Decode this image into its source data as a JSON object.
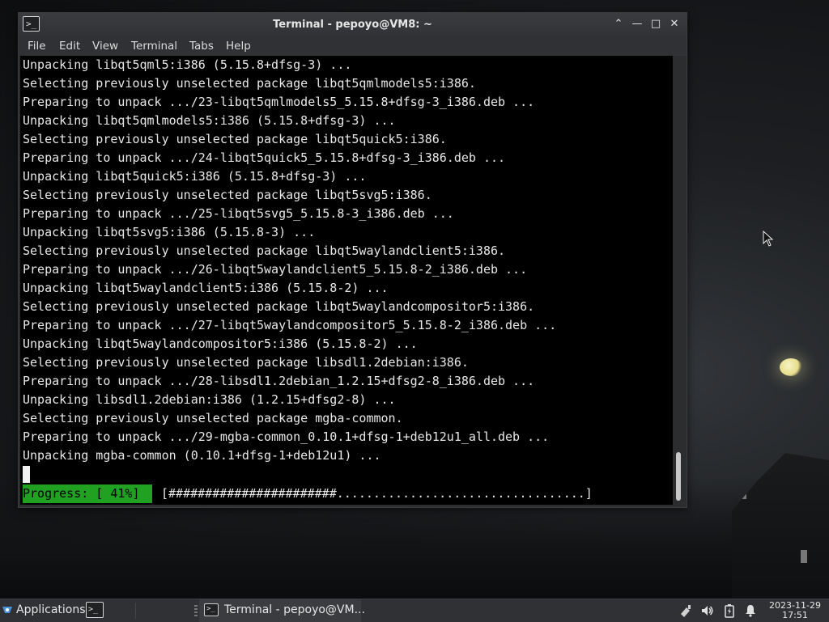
{
  "window": {
    "title": "Terminal - pepoyo@VM8: ~",
    "controls": {
      "maximize_up": "⌃",
      "minimize": "—",
      "maximize": "□",
      "close": "✕"
    }
  },
  "menubar": {
    "items": [
      "File",
      "Edit",
      "View",
      "Terminal",
      "Tabs",
      "Help"
    ]
  },
  "terminal": {
    "lines": [
      "Unpacking libqt5qml5:i386 (5.15.8+dfsg-3) ...",
      "Selecting previously unselected package libqt5qmlmodels5:i386.",
      "Preparing to unpack .../23-libqt5qmlmodels5_5.15.8+dfsg-3_i386.deb ...",
      "Unpacking libqt5qmlmodels5:i386 (5.15.8+dfsg-3) ...",
      "Selecting previously unselected package libqt5quick5:i386.",
      "Preparing to unpack .../24-libqt5quick5_5.15.8+dfsg-3_i386.deb ...",
      "Unpacking libqt5quick5:i386 (5.15.8+dfsg-3) ...",
      "Selecting previously unselected package libqt5svg5:i386.",
      "Preparing to unpack .../25-libqt5svg5_5.15.8-3_i386.deb ...",
      "Unpacking libqt5svg5:i386 (5.15.8-3) ...",
      "Selecting previously unselected package libqt5waylandclient5:i386.",
      "Preparing to unpack .../26-libqt5waylandclient5_5.15.8-2_i386.deb ...",
      "Unpacking libqt5waylandclient5:i386 (5.15.8-2) ...",
      "Selecting previously unselected package libqt5waylandcompositor5:i386.",
      "Preparing to unpack .../27-libqt5waylandcompositor5_5.15.8-2_i386.deb ...",
      "Unpacking libqt5waylandcompositor5:i386 (5.15.8-2) ...",
      "Selecting previously unselected package libsdl1.2debian:i386.",
      "Preparing to unpack .../28-libsdl1.2debian_1.2.15+dfsg2-8_i386.deb ...",
      "Unpacking libsdl1.2debian:i386 (1.2.15+dfsg2-8) ...",
      "Selecting previously unselected package mgba-common.",
      "Preparing to unpack .../29-mgba-common_0.10.1+dfsg-1+deb12u1_all.deb ...",
      "Unpacking mgba-common (0.10.1+dfsg-1+deb12u1) ..."
    ],
    "progress_label": "Progress: [ 41%]",
    "progress_bar": "[#######################..................................]",
    "progress_fraction": 0.41,
    "progress_color": "#21a121"
  },
  "taskbar": {
    "applications_label": "Applications",
    "task_label": "Terminal - pepoyo@VM...",
    "tray_icons": [
      "network-wired-icon",
      "volume-icon",
      "battery-icon",
      "notification-bell-icon"
    ],
    "clock_date": "2023-11-29",
    "clock_time": "17:51"
  }
}
